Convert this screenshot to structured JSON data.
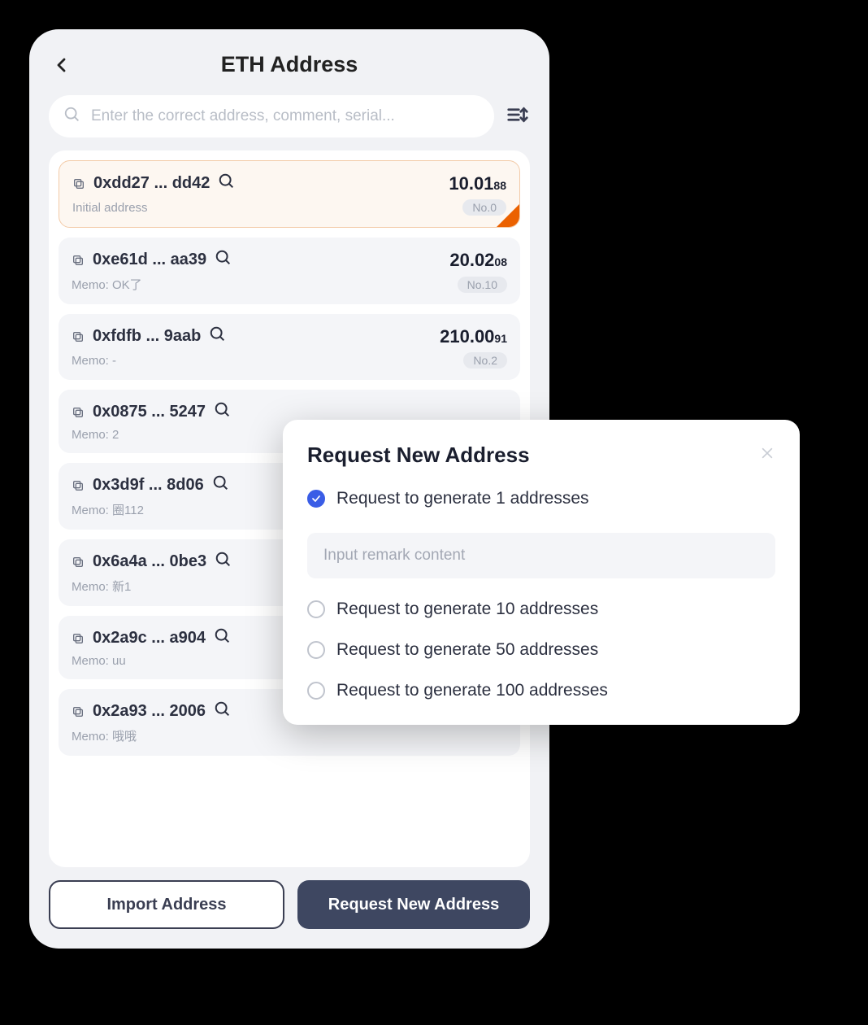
{
  "header": {
    "title": "ETH Address"
  },
  "search": {
    "placeholder": "Enter the correct address, comment, serial..."
  },
  "addresses": [
    {
      "addr": "0xdd27 ... dd42",
      "balance_main": "10.01",
      "balance_sub": "88",
      "memo": "Initial address",
      "badge": "No.0",
      "selected": true
    },
    {
      "addr": "0xe61d ... aa39",
      "balance_main": "20.02",
      "balance_sub": "08",
      "memo": "Memo: OK了",
      "badge": "No.10"
    },
    {
      "addr": "0xfdfb ... 9aab",
      "balance_main": "210.00",
      "balance_sub": "91",
      "memo": "Memo: -",
      "badge": "No.2"
    },
    {
      "addr": "0x0875 ... 5247",
      "memo": "Memo: 2"
    },
    {
      "addr": "0x3d9f ... 8d06",
      "memo": "Memo: 圈112"
    },
    {
      "addr": "0x6a4a ... 0be3",
      "memo": "Memo: 新1"
    },
    {
      "addr": "0x2a9c ... a904",
      "memo": "Memo: uu"
    },
    {
      "addr": "0x2a93 ... 2006",
      "memo": "Memo: 哦哦"
    }
  ],
  "buttons": {
    "import": "Import Address",
    "request": "Request New Address"
  },
  "modal": {
    "title": "Request New Address",
    "remark_placeholder": "Input remark content",
    "options": [
      {
        "label": "Request to generate 1 addresses",
        "checked": true,
        "has_input": true
      },
      {
        "label": "Request to generate 10 addresses"
      },
      {
        "label": "Request to generate 50 addresses"
      },
      {
        "label": "Request to generate 100 addresses"
      }
    ]
  }
}
